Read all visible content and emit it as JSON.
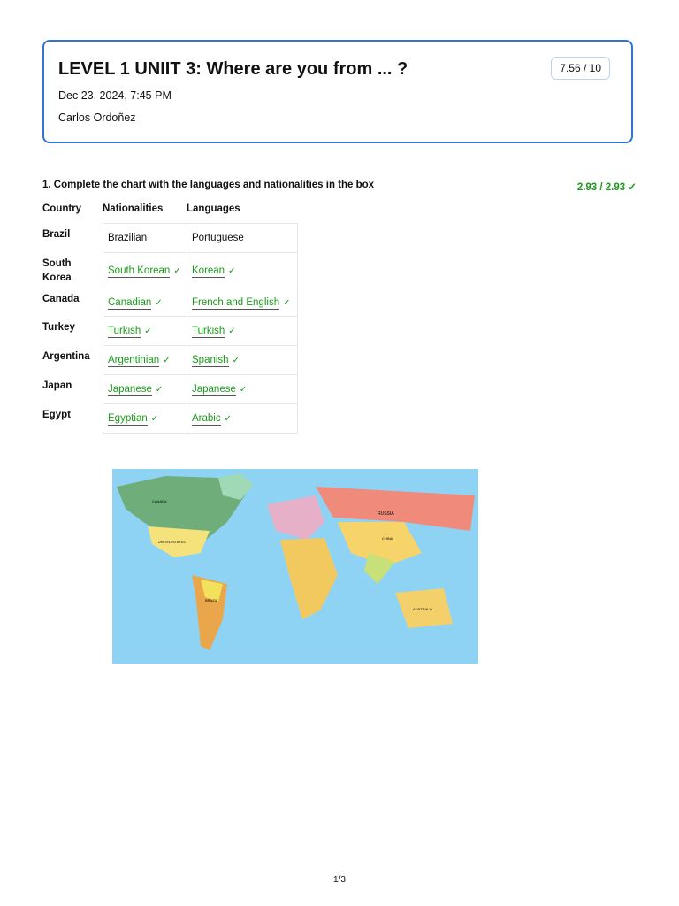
{
  "header": {
    "title": "LEVEL 1 UNIIT 3: Where are you from ... ?",
    "date": "Dec 23, 2024, 7:45 PM",
    "author": "Carlos Ordoñez",
    "score": "7.56 / 10"
  },
  "question": {
    "text": "1. Complete the chart with the languages and nationalities in the box",
    "score": "2.93  / 2.93 ✓"
  },
  "columns": [
    "Country",
    "Nationalities",
    "Languages"
  ],
  "rows": [
    {
      "country": "Brazil",
      "nationality": "Brazilian",
      "language": "Portuguese",
      "answered": false
    },
    {
      "country": "South Korea",
      "nationality": "South Korean",
      "language": "Korean",
      "answered": true
    },
    {
      "country": "Canada",
      "nationality": "Canadian",
      "language": "French and English",
      "answered": true
    },
    {
      "country": "Turkey",
      "nationality": "Turkish",
      "language": "Turkish",
      "answered": true
    },
    {
      "country": "Argentina",
      "nationality": "Argentinian",
      "language": "Spanish",
      "answered": true
    },
    {
      "country": "Japan",
      "nationality": "Japanese",
      "language": "Japanese",
      "answered": true
    },
    {
      "country": "Egypt",
      "nationality": "Egyptian",
      "language": "Arabic",
      "answered": true
    }
  ],
  "check": "✓",
  "map_labels": [
    "CANADA",
    "UNITED STATES",
    "BRAZIL",
    "RUSSIA",
    "CHINA",
    "AUSTRALIA"
  ],
  "footer": {
    "page": "1/3"
  },
  "colors": {
    "accent": "#2f74d0",
    "correct": "#1a9a1a",
    "ocean": "#8fd3f4"
  }
}
